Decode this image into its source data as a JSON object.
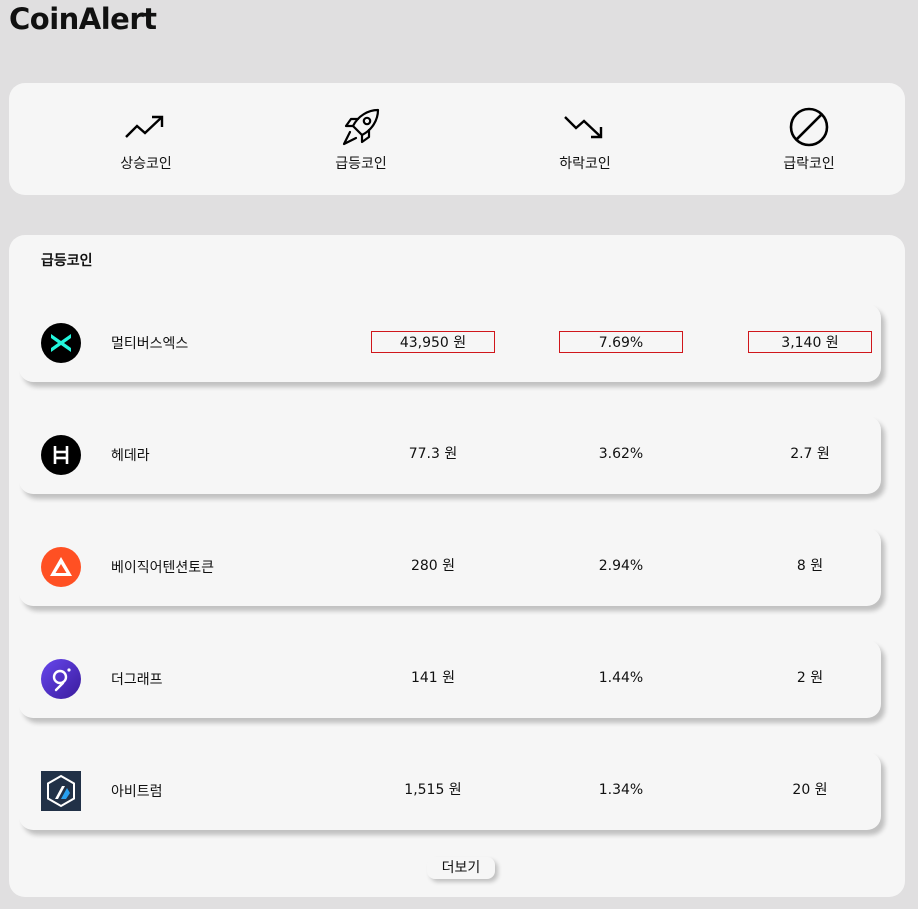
{
  "app": {
    "title": "CoinAlert"
  },
  "nav": {
    "items": [
      {
        "label": "상승코인",
        "icon": "trending-up-icon"
      },
      {
        "label": "급등코인",
        "icon": "rocket-icon"
      },
      {
        "label": "하락코인",
        "icon": "trending-down-icon"
      },
      {
        "label": "급락코인",
        "icon": "prohibited-icon"
      }
    ]
  },
  "list": {
    "title": "급등코인",
    "more_label": "더보기",
    "highlight_color": "#d0161b",
    "rows": [
      {
        "name": "멀티버스엑스",
        "price": "43,950 원",
        "change_pct": "7.69%",
        "change_amt": "3,140 원",
        "logo": "multiversx-logo-icon",
        "highlighted": true
      },
      {
        "name": "헤데라",
        "price": "77.3 원",
        "change_pct": "3.62%",
        "change_amt": "2.7 원",
        "logo": "hedera-logo-icon",
        "highlighted": false
      },
      {
        "name": "베이직어텐션토큰",
        "price": "280 원",
        "change_pct": "2.94%",
        "change_amt": "8 원",
        "logo": "bat-logo-icon",
        "highlighted": false
      },
      {
        "name": "더그래프",
        "price": "141 원",
        "change_pct": "1.44%",
        "change_amt": "2 원",
        "logo": "the-graph-logo-icon",
        "highlighted": false
      },
      {
        "name": "아비트럼",
        "price": "1,515 원",
        "change_pct": "1.34%",
        "change_amt": "20 원",
        "logo": "arbitrum-logo-icon",
        "highlighted": false
      }
    ]
  }
}
